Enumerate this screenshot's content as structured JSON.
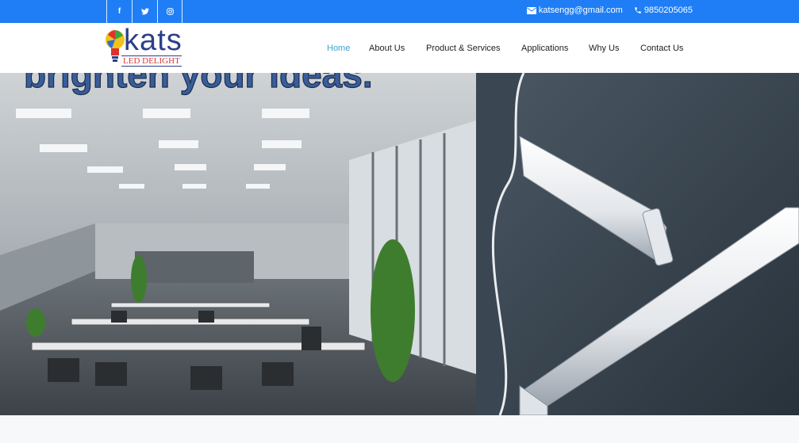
{
  "topbar": {
    "social": [
      {
        "name": "facebook-icon",
        "glyph": "f"
      },
      {
        "name": "twitter-icon",
        "glyph": "t"
      },
      {
        "name": "instagram-icon",
        "glyph": "◎"
      }
    ],
    "email": "katsengg@gmail.com",
    "phone": "9850205065",
    "bg_color": "#1f7ef5"
  },
  "logo": {
    "text": "kats",
    "tagline": "LED DELIGHT"
  },
  "nav": {
    "items": [
      "Home",
      "About Us",
      "Product & Services",
      "Applications",
      "Why Us",
      "Contact Us"
    ],
    "active_color": "#3ba3d5"
  },
  "hero": {
    "headline": "brighten your ideas."
  }
}
